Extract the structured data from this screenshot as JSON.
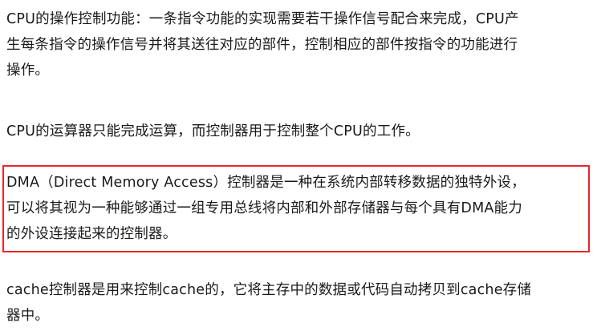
{
  "paragraphs": [
    {
      "lines": [
        "CPU的操作控制功能：一条指令功能的实现需要若干操作信号配合来完成，CPU产",
        "生每条指令的操作信号并将其送往对应的部件，控制相应的部件按指令的功能进行",
        "操作。"
      ]
    },
    {
      "lines": [
        "CPU的运算器只能完成运算，而控制器用于控制整个CPU的工作。"
      ]
    },
    {
      "lines": [
        "DMA（Direct Memory Access）控制器是一种在系统内部转移数据的独特外设，",
        "可以将其视为一种能够通过一组专用总线将内部和外部存储器与每个具有DMA能力",
        "的外设连接起来的控制器。"
      ],
      "highlighted": true
    },
    {
      "lines": [
        "cache控制器是用来控制cache的，它将主存中的数据或代码自动拷贝到cache存储",
        "器中。"
      ]
    }
  ],
  "colors": {
    "text": "#1a1a1a",
    "highlight_border": "#e8262b",
    "background": "#ffffff"
  }
}
